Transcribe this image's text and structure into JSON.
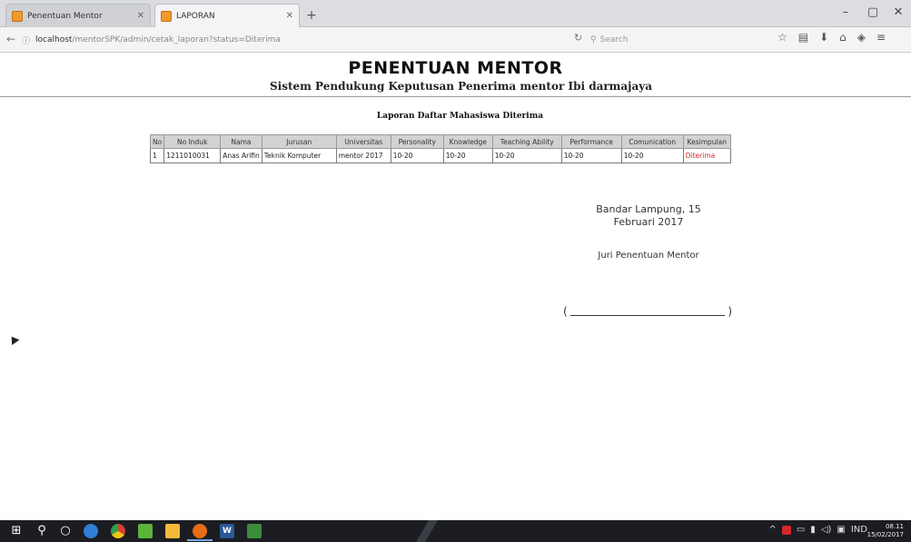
{
  "browser": {
    "tabs": [
      {
        "title": "Penentuan Mentor",
        "active": false
      },
      {
        "title": "LAPORAN",
        "active": true
      }
    ],
    "url": {
      "host": "localhost",
      "path": "/mentorSPK/admin/cetak_laporan?status=Diterima"
    },
    "search_placeholder": "Search",
    "icons": [
      "back-icon",
      "info-icon",
      "reload-icon",
      "star-icon",
      "reader-icon",
      "download-icon",
      "home-icon",
      "pocket-icon",
      "menu-icon"
    ]
  },
  "page": {
    "title": "PENENTUAN MENTOR",
    "subtitle": "Sistem Pendukung Keputusan Penerima mentor Ibi darmajaya",
    "report_heading": "Laporan Daftar Mahasiswa Diterima",
    "table": {
      "headers": [
        "No",
        "No Induk",
        "Nama",
        "Jurusan",
        "Universitas",
        "Personality",
        "Knowledge",
        "Teaching Ability",
        "Performance",
        "Comunication",
        "Kesimpulan"
      ],
      "rows": [
        [
          "1",
          "1211010031",
          "Anas Arifin",
          "Teknik Komputer",
          "mentor 2017",
          "10-20",
          "10-20",
          "10-20",
          "10-20",
          "10-20",
          "Diterima"
        ]
      ]
    },
    "signature": {
      "place_date_line1": "Bandar Lampung, 15",
      "place_date_line2": "Februari 2017",
      "role": "Juri Penentuan Mentor",
      "open_paren": "(",
      "close_paren": ")"
    }
  },
  "taskbar": {
    "clock_time": "08.11",
    "clock_date": "15/02/2017",
    "language": "IND",
    "accent_color": "#1b1d22"
  },
  "colors": {
    "accepted_text": "#d62a2a",
    "table_header_bg": "#d2d2d2"
  }
}
